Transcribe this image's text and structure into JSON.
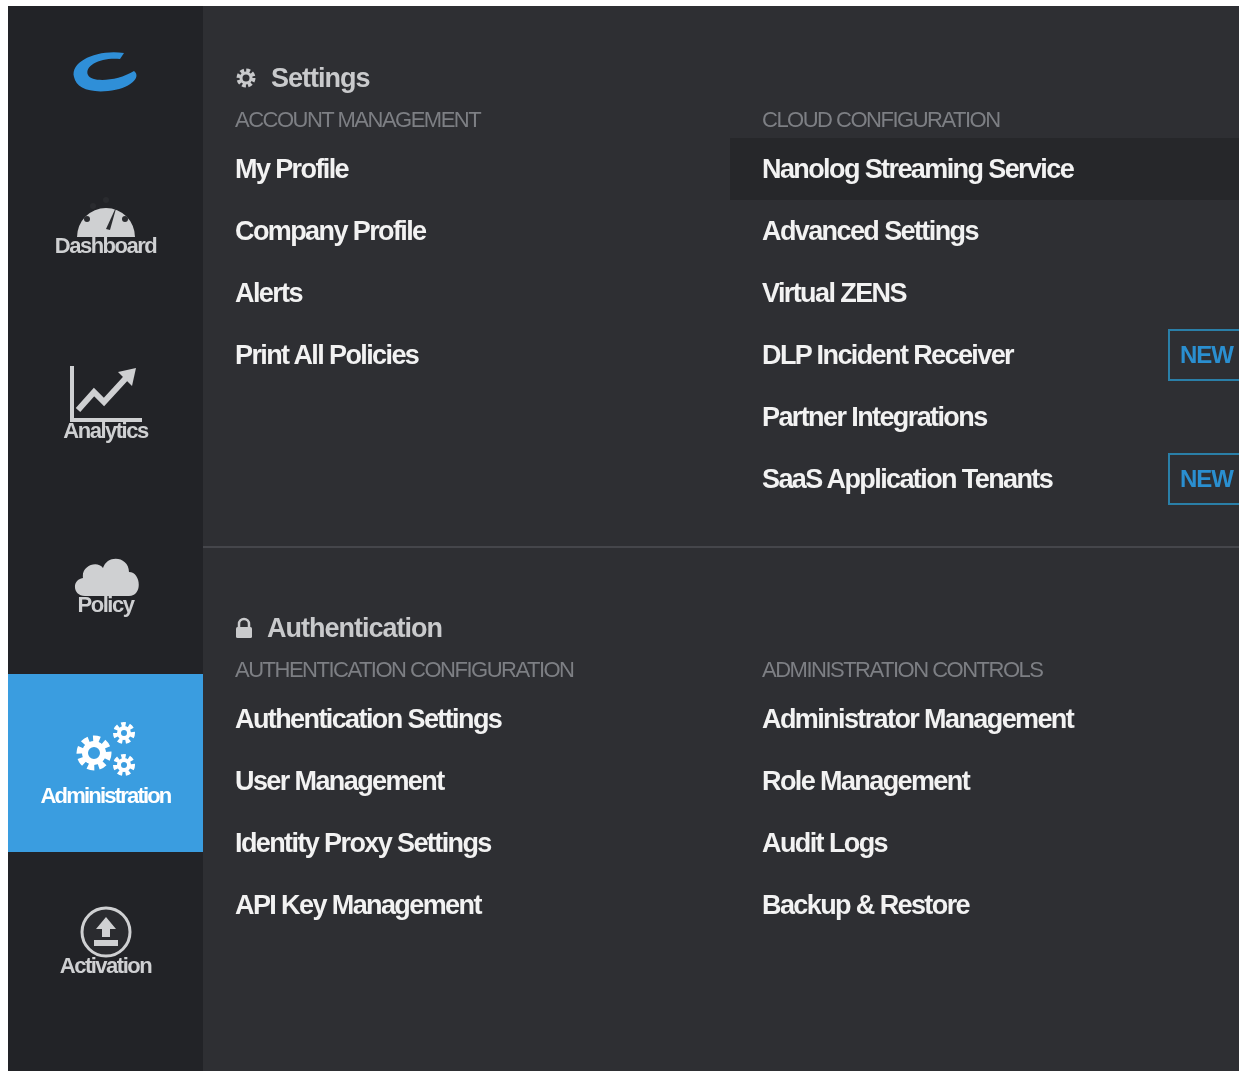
{
  "sidebar": {
    "items": [
      {
        "label": "Dashboard",
        "kind": "gauge",
        "selected": false
      },
      {
        "label": "Analytics",
        "kind": "chart",
        "selected": false
      },
      {
        "label": "Policy",
        "kind": "cloud",
        "selected": false
      },
      {
        "label": "Administration",
        "kind": "gears",
        "selected": true
      },
      {
        "label": "Activation",
        "kind": "upload",
        "selected": false
      }
    ]
  },
  "sections": [
    {
      "title": "Settings",
      "kind": "gear",
      "groups": [
        {
          "heading": "ACCOUNT MANAGEMENT",
          "items": [
            {
              "label": "My Profile",
              "selected": false
            },
            {
              "label": "Company Profile",
              "selected": false
            },
            {
              "label": "Alerts",
              "selected": false
            },
            {
              "label": "Print All Policies",
              "selected": false
            }
          ]
        },
        {
          "heading": "CLOUD CONFIGURATION",
          "items": [
            {
              "label": "Nanolog Streaming Service",
              "selected": true
            },
            {
              "label": "Advanced Settings",
              "selected": false
            },
            {
              "label": "Virtual ZENS",
              "selected": false
            },
            {
              "label": "DLP Incident Receiver",
              "selected": false,
              "badge": "NEW"
            },
            {
              "label": "Partner Integrations",
              "selected": false
            },
            {
              "label": "SaaS Application Tenants",
              "selected": false,
              "badge": "NEW"
            }
          ]
        }
      ]
    },
    {
      "title": "Authentication",
      "kind": "lock",
      "groups": [
        {
          "heading": "AUTHENTICATION CONFIGURATION",
          "items": [
            {
              "label": "Authentication Settings",
              "selected": false
            },
            {
              "label": "User Management",
              "selected": false
            },
            {
              "label": "Identity Proxy Settings",
              "selected": false
            },
            {
              "label": "API Key Management",
              "selected": false
            }
          ]
        },
        {
          "heading": "ADMINISTRATION CONTROLS",
          "items": [
            {
              "label": "Administrator Management",
              "selected": false
            },
            {
              "label": "Role Management",
              "selected": false
            },
            {
              "label": "Audit Logs",
              "selected": false
            },
            {
              "label": "Backup & Restore",
              "selected": false
            }
          ]
        }
      ]
    }
  ]
}
